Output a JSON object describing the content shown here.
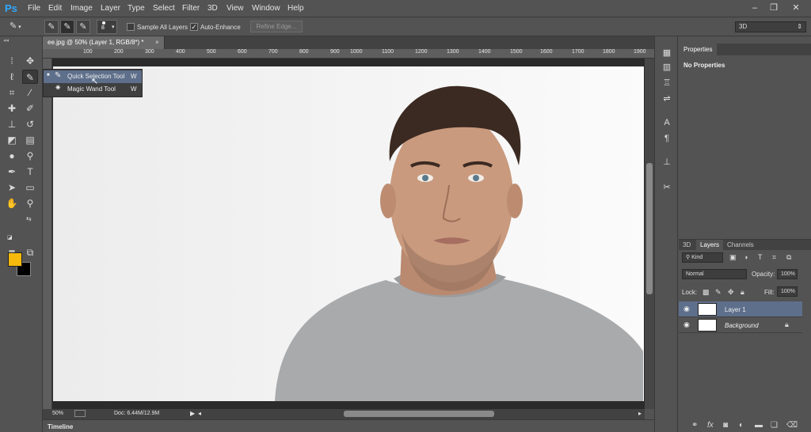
{
  "app": {
    "logo": "Ps"
  },
  "menu": [
    "File",
    "Edit",
    "Image",
    "Layer",
    "Type",
    "Select",
    "Filter",
    "3D",
    "View",
    "Window",
    "Help"
  ],
  "window_controls": {
    "minimize": "–",
    "restore": "❐",
    "close": "✕"
  },
  "options_bar": {
    "brush_size": "8",
    "sample_all_layers": {
      "label": "Sample All Layers",
      "checked": false
    },
    "auto_enhance": {
      "label": "Auto-Enhance",
      "checked": true
    },
    "refine_edge": "Refine Edge...",
    "workspace": "3D"
  },
  "document_tab": {
    "title": "ee.jpg @ 50% (Layer 1, RGB/8*) *",
    "close": "×"
  },
  "ruler_numbers": [
    "100",
    "200",
    "300",
    "400",
    "500",
    "600",
    "700",
    "800",
    "900",
    "1000",
    "1100",
    "1200",
    "1300",
    "1400",
    "1500",
    "1600",
    "1700",
    "1800",
    "1900"
  ],
  "tool_flyout": [
    {
      "label": "Quick Selection Tool",
      "shortcut": "W",
      "icon": "quick-selection-icon",
      "selected": true
    },
    {
      "label": "Magic Wand Tool",
      "shortcut": "W",
      "icon": "magic-wand-icon",
      "selected": false
    }
  ],
  "colors": {
    "foreground": "#f6b90c",
    "background": "#000000",
    "selection": "#5e6f8b"
  },
  "status_bar": {
    "zoom": "50%",
    "doc_size": "Doc: 6.44M/12.9M"
  },
  "timeline": {
    "label": "Timeline"
  },
  "properties_panel": {
    "tab": "Properties",
    "content": "No Properties"
  },
  "layers_panel": {
    "tabs": [
      "3D",
      "Layers",
      "Channels"
    ],
    "active_tab": "Layers",
    "filter_kind": "Kind",
    "blend_mode": "Normal",
    "opacity_label": "Opacity:",
    "opacity": "100%",
    "lock_label": "Lock:",
    "fill_label": "Fill:",
    "fill": "100%",
    "layers": [
      {
        "name": "Layer 1",
        "selected": true,
        "locked": false,
        "italic": false
      },
      {
        "name": "Background",
        "selected": false,
        "locked": true,
        "italic": true
      }
    ]
  }
}
